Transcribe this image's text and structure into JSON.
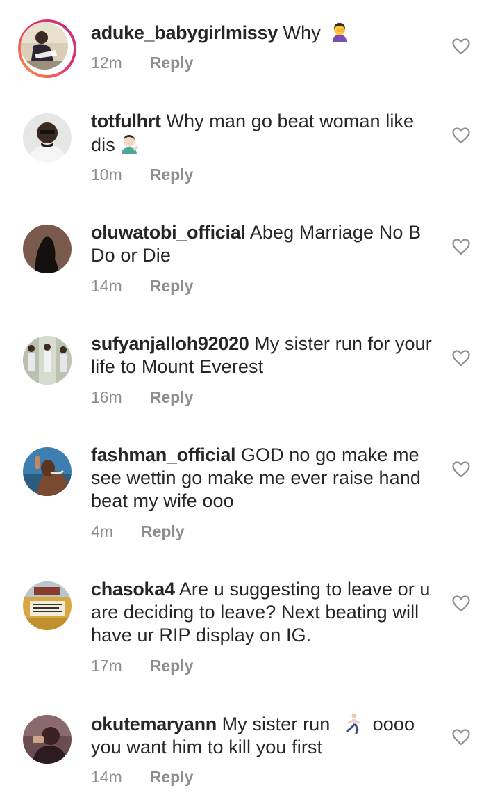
{
  "comments": [
    {
      "username": "aduke_babygirlmissy",
      "text": "Why",
      "emoji": "woman-facepalming-emoji",
      "time": "12m",
      "reply": "Reply",
      "like_icon": "heart-outline-icon",
      "has_story": true
    },
    {
      "username": "totfulhrt",
      "text": "Why man go beat woman like dis",
      "emoji": "man-tipping-hand-emoji",
      "time": "10m",
      "reply": "Reply",
      "like_icon": "heart-outline-icon"
    },
    {
      "username": "oluwatobi_official",
      "text": "Abeg Marriage No B Do or Die",
      "time": "14m",
      "reply": "Reply",
      "like_icon": "heart-outline-icon"
    },
    {
      "username": "sufyanjalloh92020",
      "text": "My sister run for your life to Mount Everest",
      "time": "16m",
      "reply": "Reply",
      "like_icon": "heart-outline-icon"
    },
    {
      "username": "fashman_official",
      "text": "GOD no go make me see wettin go make me ever raise hand beat my wife ooo",
      "time": "4m",
      "reply": "Reply",
      "like_icon": "heart-outline-icon"
    },
    {
      "username": "chasoka4",
      "text": "Are u suggesting to leave or u are deciding to leave? Next beating will have ur RIP display on IG.",
      "time": "17m",
      "reply": "Reply",
      "like_icon": "heart-outline-icon"
    },
    {
      "username": "okutemaryann",
      "text_before_emoji": "My sister run",
      "emoji": "woman-running-emoji",
      "text_after_emoji": "oooo you want him to kill you first",
      "time": "14m",
      "reply": "Reply",
      "like_icon": "heart-outline-icon"
    }
  ],
  "colors": {
    "text": "#262626",
    "meta": "#8e8e8e",
    "background": "#ffffff"
  }
}
